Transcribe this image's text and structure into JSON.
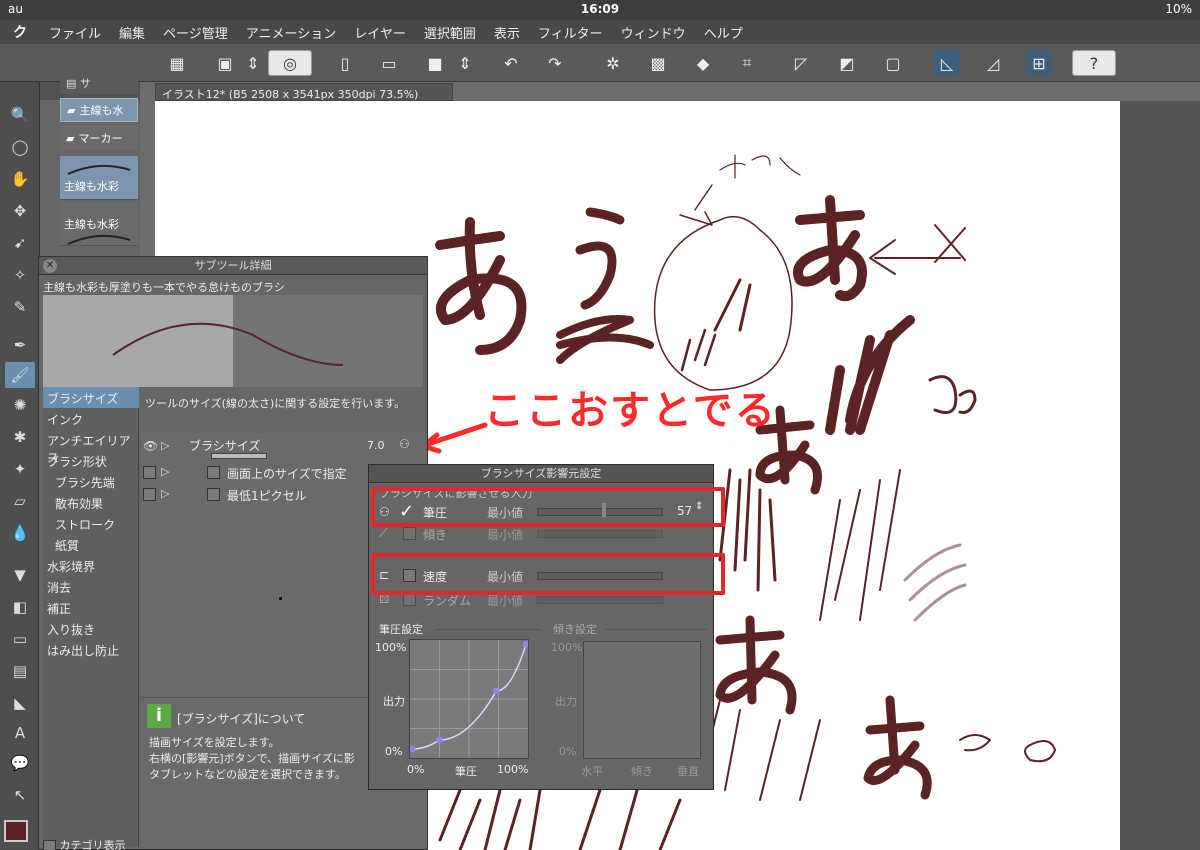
{
  "status": {
    "carrier": "au",
    "time": "16:09",
    "battery": "10%"
  },
  "menu": [
    "ファイル",
    "編集",
    "ページ管理",
    "アニメーション",
    "レイヤー",
    "選択範囲",
    "表示",
    "フィルター",
    "ウィンドウ",
    "ヘルプ"
  ],
  "subtool": {
    "tab_label": "サ",
    "items": [
      "主線も水",
      "マーカー"
    ],
    "brushes": [
      "主線も水彩",
      "主線も水彩"
    ]
  },
  "document": {
    "tab": "イラスト12* (B5 2508 x 3541px 350dpi 73.5%)"
  },
  "detail": {
    "title": "サブツール詳細",
    "brush_name": "主線も水彩も厚塗りも一本でやる怠けものブラシ",
    "categories": [
      "ブラシサイズ",
      "インク",
      "アンチエイリアス",
      "ブラシ形状",
      "ブラシ先端",
      "散布効果",
      "ストローク",
      "紙質",
      "水彩境界",
      "消去",
      "補正",
      "入り抜き",
      "はみ出し防止"
    ],
    "category_footer": "カテゴリ表示",
    "setting_description": "ツールのサイズ(線の太さ)に関する設定を行います。",
    "brush_size_label": "ブラシサイズ",
    "brush_size_value": "7.0",
    "on_screen_size": "画面上のサイズで指定",
    "min_1px": "最低1ピクセル",
    "info_title": "[ブラシサイズ]について",
    "info_line1": "描画サイズを設定します。",
    "info_line2": "右横の[影響元]ボタンで、描画サイズに影",
    "info_line3": "タブレットなどの設定を選択できます。"
  },
  "influence": {
    "title": "ブラシサイズ影響元設定",
    "subtitle": "ブラシサイズに影響させる入力",
    "rows": [
      {
        "label": "筆圧",
        "min_label": "最小値",
        "value": "57",
        "checked": true
      },
      {
        "label": "傾き",
        "min_label": "最小値"
      },
      {
        "label": "速度",
        "min_label": "最小値"
      },
      {
        "label": "ランダム",
        "min_label": "最小値"
      }
    ],
    "pressure_section": "筆圧設定",
    "tilt_section": "傾き設定",
    "y_top": "100%",
    "y_mid": "出力",
    "y_bottom": "0%",
    "x_left": "0%",
    "x_mid": "筆圧",
    "x_right": "100%",
    "tilt_x_left": "水平",
    "tilt_x_mid": "傾き",
    "tilt_x_right": "垂直",
    "curve_points": [
      [
        0,
        0.06
      ],
      [
        0.24,
        0.14
      ],
      [
        0.74,
        0.57
      ],
      [
        1.0,
        0.98
      ]
    ]
  },
  "annotation": "ここおすとでる",
  "colors": {
    "annotation": "#ff2b2b",
    "ink": "#5b2323",
    "selection": "#6b8fb0"
  }
}
